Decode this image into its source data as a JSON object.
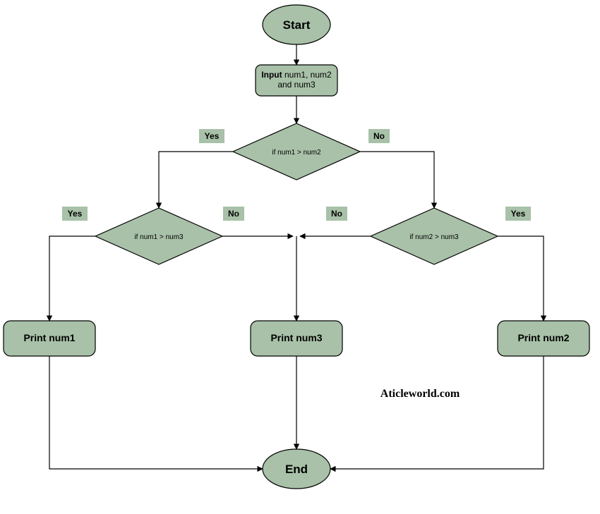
{
  "nodes": {
    "start": "Start",
    "end": "End",
    "input_bold": "Input",
    "input_rest": " num1, num2",
    "input_line2": "and num3",
    "dec1": "if num1 > num2",
    "dec2": "if num1 > num3",
    "dec3": "if num2 > num3",
    "print1": "Print num1",
    "print2": "Print num2",
    "print3": "Print num3"
  },
  "labels": {
    "yes": "Yes",
    "no": "No"
  },
  "watermark": "Aticleworld.com"
}
